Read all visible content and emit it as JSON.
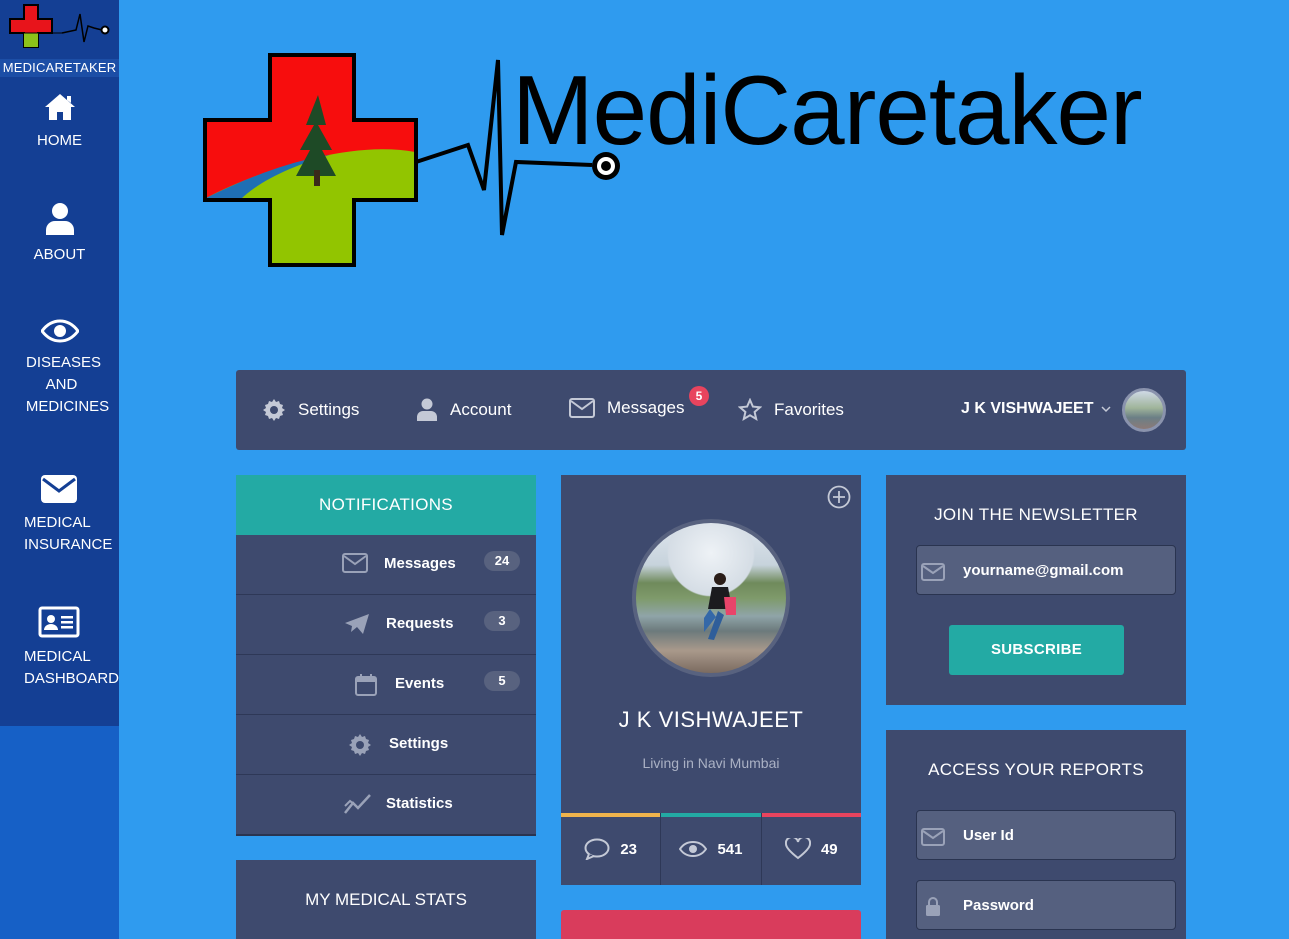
{
  "sidebar": {
    "brand": "MEDICARETAKER",
    "items": [
      {
        "label": "HOME",
        "icon": "home-icon"
      },
      {
        "label": "ABOUT",
        "icon": "user-icon"
      },
      {
        "label_lines": [
          "DISEASES",
          "AND",
          "MEDICINES"
        ],
        "icon": "eye-icon"
      },
      {
        "label_lines": [
          "MEDICAL",
          "INSURANCE"
        ],
        "icon": "envelope-icon"
      },
      {
        "label_lines": [
          "MEDICAL",
          "DASHBOARD"
        ],
        "icon": "id-card-icon"
      }
    ]
  },
  "hero": {
    "title": "MediCaretaker"
  },
  "topnav": {
    "items": [
      {
        "label": "Settings",
        "icon": "gear-icon"
      },
      {
        "label": "Account",
        "icon": "user-icon"
      },
      {
        "label": "Messages",
        "icon": "envelope-icon",
        "badge": "5"
      },
      {
        "label": "Favorites",
        "icon": "star-icon"
      }
    ],
    "user": "J K VISHWAJEET"
  },
  "notifications": {
    "title": "NOTIFICATIONS",
    "rows": [
      {
        "label": "Messages",
        "count": "24",
        "icon": "envelope-icon"
      },
      {
        "label": "Requests",
        "count": "3",
        "icon": "paper-plane-icon"
      },
      {
        "label": "Events",
        "count": "5",
        "icon": "calendar-icon"
      },
      {
        "label": "Settings",
        "icon": "gear-icon"
      },
      {
        "label": "Statistics",
        "icon": "chart-line-icon"
      }
    ]
  },
  "medical_stats": {
    "title": "MY MEDICAL STATS"
  },
  "profile": {
    "name": "J K VISHWAJEET",
    "location": "Living in Navi Mumbai",
    "stats": [
      {
        "value": "23",
        "icon": "comment-icon",
        "color": "#f0b44c"
      },
      {
        "value": "541",
        "icon": "eye-icon",
        "color": "#23aaa4"
      },
      {
        "value": "49",
        "icon": "heart-icon",
        "color": "#e8445e"
      }
    ]
  },
  "newsletter": {
    "title": "JOIN THE NEWSLETTER",
    "email_value": "yourname@gmail.com",
    "subscribe_label": "SUBSCRIBE"
  },
  "reports": {
    "title": "ACCESS YOUR REPORTS",
    "user_id_placeholder": "User Id",
    "password_placeholder": "Password"
  },
  "colors": {
    "background": "#2f9bef",
    "sidebar": "#143f94",
    "panel": "#3e4a6e",
    "teal": "#23aaa4",
    "red": "#e8445e"
  }
}
